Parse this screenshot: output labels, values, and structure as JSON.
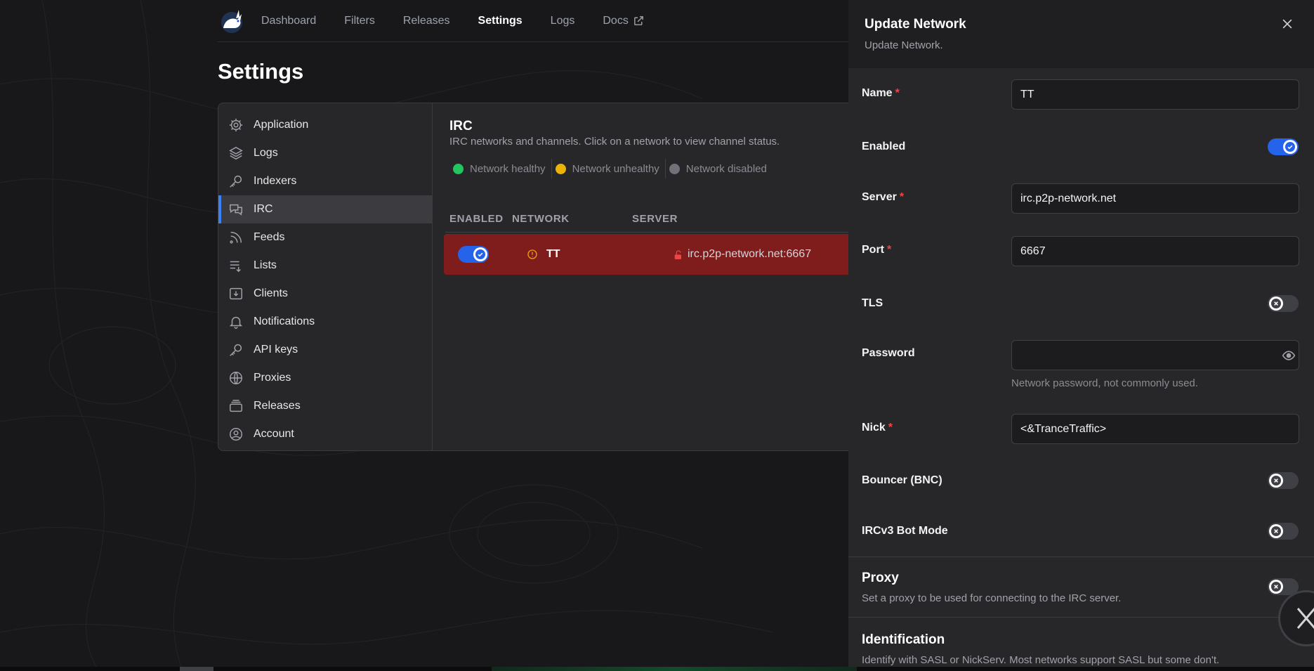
{
  "nav": {
    "items": [
      "Dashboard",
      "Filters",
      "Releases",
      "Settings",
      "Logs",
      "Docs"
    ],
    "active": "Settings"
  },
  "page": {
    "title": "Settings"
  },
  "sidebar": {
    "items": [
      {
        "label": "Application",
        "icon": "gear-icon"
      },
      {
        "label": "Logs",
        "icon": "layers-icon"
      },
      {
        "label": "Indexers",
        "icon": "key-icon"
      },
      {
        "label": "IRC",
        "icon": "chat-bubbles-icon"
      },
      {
        "label": "Feeds",
        "icon": "rss-icon"
      },
      {
        "label": "Lists",
        "icon": "list-icon"
      },
      {
        "label": "Clients",
        "icon": "download-tray-icon"
      },
      {
        "label": "Notifications",
        "icon": "bell-icon"
      },
      {
        "label": "API keys",
        "icon": "key-icon"
      },
      {
        "label": "Proxies",
        "icon": "globe-icon"
      },
      {
        "label": "Releases",
        "icon": "stack-icon"
      },
      {
        "label": "Account",
        "icon": "user-circle-icon"
      }
    ],
    "active": "IRC"
  },
  "irc": {
    "title": "IRC",
    "description": "IRC networks and channels. Click on a network to view channel status.",
    "legend": [
      {
        "label": "Network healthy",
        "color": "#22c55e"
      },
      {
        "label": "Network unhealthy",
        "color": "#eab308"
      },
      {
        "label": "Network disabled",
        "color": "#71717a"
      }
    ],
    "columns": [
      "ENABLED",
      "NETWORK",
      "SERVER"
    ],
    "rows": [
      {
        "enabled": true,
        "network": "TT",
        "server": "irc.p2p-network.net:6667",
        "status_color": "#f59e0b",
        "row_color": "#7f1d1d"
      }
    ]
  },
  "drawer": {
    "title": "Update Network",
    "subtitle": "Update Network.",
    "fields": {
      "name": {
        "label": "Name",
        "value": "TT"
      },
      "enabled": {
        "label": "Enabled",
        "value": true
      },
      "server": {
        "label": "Server",
        "value": "irc.p2p-network.net"
      },
      "port": {
        "label": "Port",
        "value": "6667"
      },
      "tls": {
        "label": "TLS",
        "value": false
      },
      "password": {
        "label": "Password",
        "value": "",
        "help": "Network password, not commonly used."
      },
      "nick": {
        "label": "Nick",
        "value": "<&TranceTraffic>"
      },
      "bouncer": {
        "label": "Bouncer (BNC)",
        "value": false
      },
      "botmode": {
        "label": "IRCv3 Bot Mode",
        "value": false
      }
    },
    "proxy": {
      "title": "Proxy",
      "description": "Set a proxy to be used for connecting to the IRC server.",
      "enabled": false
    },
    "identification": {
      "title": "Identification",
      "description": "Identify with SASL or NickServ. Most networks support SASL but some don't."
    }
  },
  "colors": {
    "accent": "#3b82f6",
    "toggle_on": "#2563eb",
    "required": "#ef4444"
  }
}
